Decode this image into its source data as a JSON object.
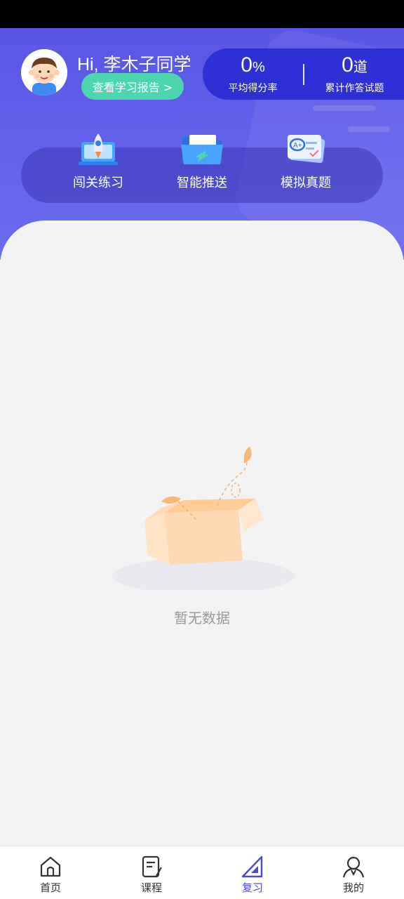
{
  "header": {
    "greeting": "Hi, 李木子同学",
    "report_button": "查看学习报告 >"
  },
  "stats": {
    "avg_score": {
      "value": "0",
      "unit": "%",
      "label": "平均得分率"
    },
    "total_questions": {
      "value": "0",
      "unit": "道",
      "label": "累计作答试题"
    }
  },
  "menu": [
    {
      "label": "闯关练习",
      "icon": "rocket-laptop-icon"
    },
    {
      "label": "智能推送",
      "icon": "folder-push-icon"
    },
    {
      "label": "模拟真题",
      "icon": "exam-paper-icon"
    }
  ],
  "empty": {
    "text": "暂无数据",
    "icon": "empty-box-icon"
  },
  "tabbar": [
    {
      "label": "首页",
      "icon": "home-icon",
      "active": false
    },
    {
      "label": "课程",
      "icon": "course-icon",
      "active": false
    },
    {
      "label": "复习",
      "icon": "review-icon",
      "active": true
    },
    {
      "label": "我的",
      "icon": "profile-icon",
      "active": false
    }
  ],
  "colors": {
    "header_bg": "#5a55e6",
    "stats_bg": "#2f2fd6",
    "report_button_bg": "#4dd5b0",
    "active_tab": "#4a4ad8"
  }
}
